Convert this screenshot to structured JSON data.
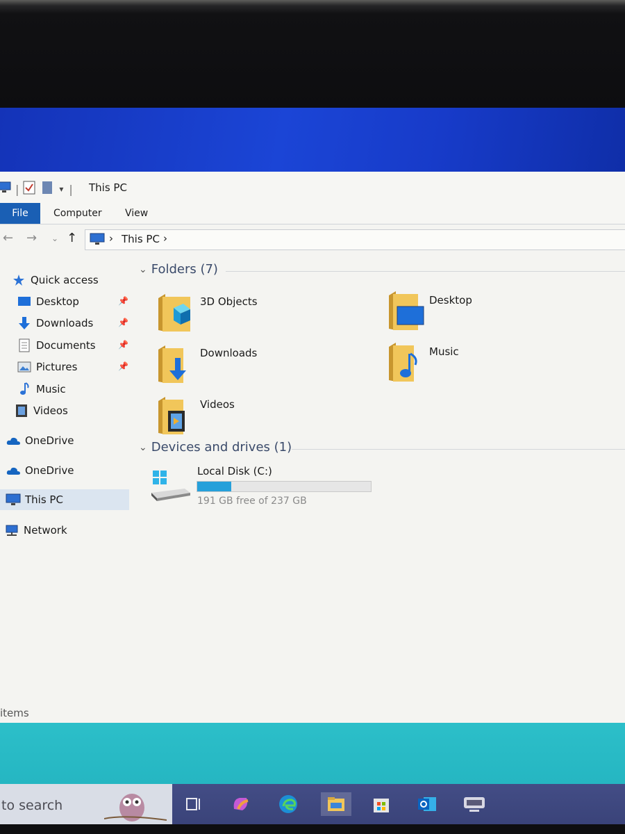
{
  "window": {
    "title": "This PC",
    "ribbon_tabs": [
      "File",
      "Computer",
      "View"
    ],
    "address_path": "This PC",
    "address_sep": "›"
  },
  "sidebar": {
    "items": [
      {
        "label": "Quick access",
        "icon": "star-icon"
      },
      {
        "label": "Desktop",
        "icon": "desktop-icon",
        "pinned": true
      },
      {
        "label": "Downloads",
        "icon": "download-arrow-icon",
        "pinned": true
      },
      {
        "label": "Documents",
        "icon": "document-icon",
        "pinned": true
      },
      {
        "label": "Pictures",
        "icon": "pictures-icon",
        "pinned": true
      },
      {
        "label": "Music",
        "icon": "music-note-icon"
      },
      {
        "label": "Videos",
        "icon": "film-icon"
      },
      {
        "label": "OneDrive",
        "icon": "cloud-icon"
      },
      {
        "label": "OneDrive",
        "icon": "cloud-icon"
      },
      {
        "label": "This PC",
        "icon": "computer-icon",
        "selected": true
      },
      {
        "label": "Network",
        "icon": "network-icon"
      }
    ]
  },
  "content": {
    "folders_header": "Folders (7)",
    "folders": [
      {
        "label": "3D Objects",
        "icon": "3d-objects-folder-icon"
      },
      {
        "label": "Desktop",
        "icon": "desktop-folder-icon"
      },
      {
        "label": "Downloads",
        "icon": "downloads-folder-icon"
      },
      {
        "label": "Music",
        "icon": "music-folder-icon"
      },
      {
        "label": "Videos",
        "icon": "videos-folder-icon"
      }
    ],
    "devices_header": "Devices and drives (1)",
    "drive": {
      "label": "Local Disk (C:)",
      "free_text": "191 GB free of 237 GB",
      "used_fraction": 0.194,
      "bar_color": "#26a0da"
    }
  },
  "status_bar": {
    "text": "items"
  },
  "taskbar": {
    "search_text": "to search",
    "icons": [
      "task-view-icon",
      "copilot-icon",
      "edge-icon",
      "file-explorer-icon",
      "store-icon",
      "outlook-icon",
      "app-icon"
    ]
  },
  "colors": {
    "accent": "#1a5fb4",
    "desktop": "#1b45d6",
    "taskbar": "#3f4880",
    "teal": "#2cbfc9"
  }
}
